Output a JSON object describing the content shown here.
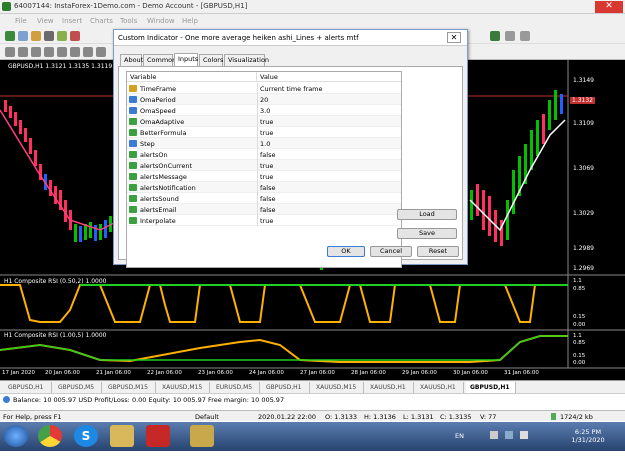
{
  "window": {
    "title": "64007144: InstaForex-1Demo.com - Demo Account - [GBPUSD,H1]"
  },
  "menu": [
    "File",
    "View",
    "Insert",
    "Charts",
    "Tools",
    "Window",
    "Help"
  ],
  "chart": {
    "symbol_info": "GBPUSD,H1  1.3121 1.3135 1.3119 1.3131",
    "price_labels": [
      "1.3149",
      "1.3132",
      "1.3109",
      "1.3069",
      "1.3029",
      "1.2989",
      "1.2969"
    ],
    "sub1_label": "H1 Composite RSI (0.50,2) 1.0000",
    "sub1_scale": [
      "1.1",
      "0.85",
      "0.15",
      "0.00"
    ],
    "sub2_label": "H1 Composite RSI (1.00,5) 1.0000",
    "sub2_scale": [
      "1.1",
      "0.85",
      "0.15",
      "0.00"
    ],
    "time_labels": [
      "17 Jan 2020",
      "20 Jan 06:00",
      "21 Jan 06:00",
      "22 Jan 06:00",
      "23 Jan 06:00",
      "24 Jan 06:00",
      "27 Jan 06:00",
      "28 Jan 06:00",
      "29 Jan 06:00",
      "30 Jan 06:00",
      "31 Jan 06:00",
      "31 Jan 14:00"
    ]
  },
  "dialog": {
    "title": "Custom Indicator - One more average heiken ashi_Lines + alerts mtf",
    "tabs": [
      "About",
      "Common",
      "Inputs",
      "Colors",
      "Visualization"
    ],
    "active_tab": "Inputs",
    "col_variable": "Variable",
    "col_value": "Value",
    "rows": [
      {
        "name": "TimeFrame",
        "value": "Current time frame",
        "icon": "ab-icon"
      },
      {
        "name": "OmaPeriod",
        "value": "20",
        "icon": "num-icon"
      },
      {
        "name": "OmaSpeed",
        "value": "3.0",
        "icon": "num-icon"
      },
      {
        "name": "OmaAdaptive",
        "value": "true",
        "icon": "bool-icon"
      },
      {
        "name": "BetterFormula",
        "value": "true",
        "icon": "bool-icon"
      },
      {
        "name": "Step",
        "value": "1.0",
        "icon": "num-icon"
      },
      {
        "name": "alertsOn",
        "value": "false",
        "icon": "bool-icon"
      },
      {
        "name": "alertsOnCurrent",
        "value": "true",
        "icon": "bool-icon"
      },
      {
        "name": "alertsMessage",
        "value": "true",
        "icon": "bool-icon"
      },
      {
        "name": "alertsNotification",
        "value": "false",
        "icon": "bool-icon"
      },
      {
        "name": "alertsSound",
        "value": "false",
        "icon": "bool-icon"
      },
      {
        "name": "alertsEmail",
        "value": "false",
        "icon": "bool-icon"
      },
      {
        "name": "Interpolate",
        "value": "true",
        "icon": "bool-icon"
      }
    ],
    "load": "Load",
    "save": "Save",
    "ok": "OK",
    "cancel": "Cancel",
    "reset": "Reset"
  },
  "chart_tabs": [
    "GBPUSD,H1",
    "GBPUSD,M5",
    "GBPUSD,M15",
    "XAUUSD,M15",
    "EURUSD,M5",
    "GBPUSD,H1",
    "XAUUSD,M15",
    "XAUUSD,H1",
    "XAUUSD,H1",
    "GBPUSD,H1"
  ],
  "active_chart_tab": 9,
  "balance": "Balance: 10 005.97 USD  Profit/Loss: 0.00  Equity: 10 005.97  Free margin: 10 005.97",
  "status": {
    "help": "For Help, press F1",
    "profile": "Default",
    "time": "2020.01.22 22:00",
    "open": "O: 1.3133",
    "high": "H: 1.3136",
    "low": "L: 1.3131",
    "close": "C: 1.3135",
    "volume": "V: 77",
    "traffic": "1724/2 kb"
  },
  "taskbar": {
    "lang": "EN",
    "time": "6:25 PM",
    "date": "1/31/2020"
  },
  "colors": {
    "up": "#00c000",
    "down": "#ff3060",
    "blue": "#2060ff",
    "rsi": "#ffb000",
    "line": "#ffffff",
    "bg": "#000000"
  }
}
